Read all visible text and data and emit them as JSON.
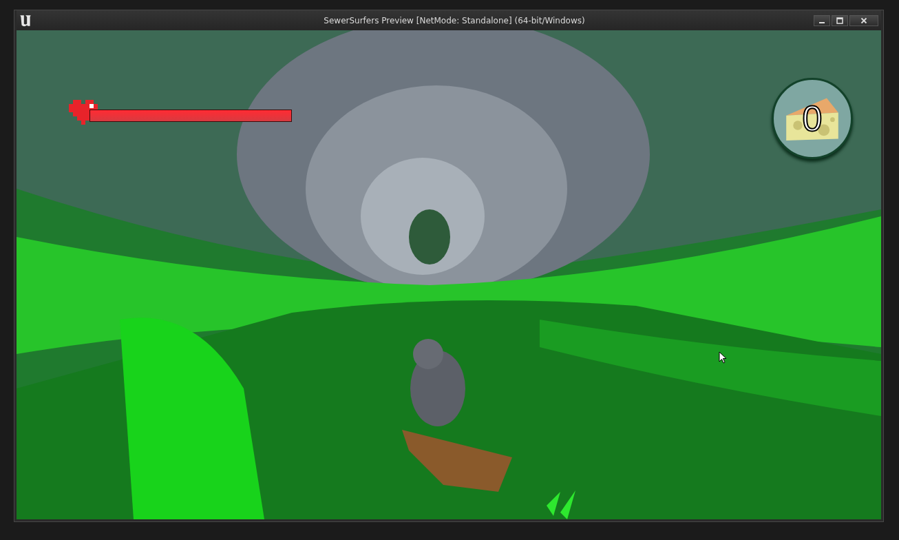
{
  "window": {
    "title": "SewerSurfers Preview [NetMode: Standalone]  (64-bit/Windows)"
  },
  "hud": {
    "health": {
      "level": 1.0
    },
    "cheese_count": "0"
  }
}
